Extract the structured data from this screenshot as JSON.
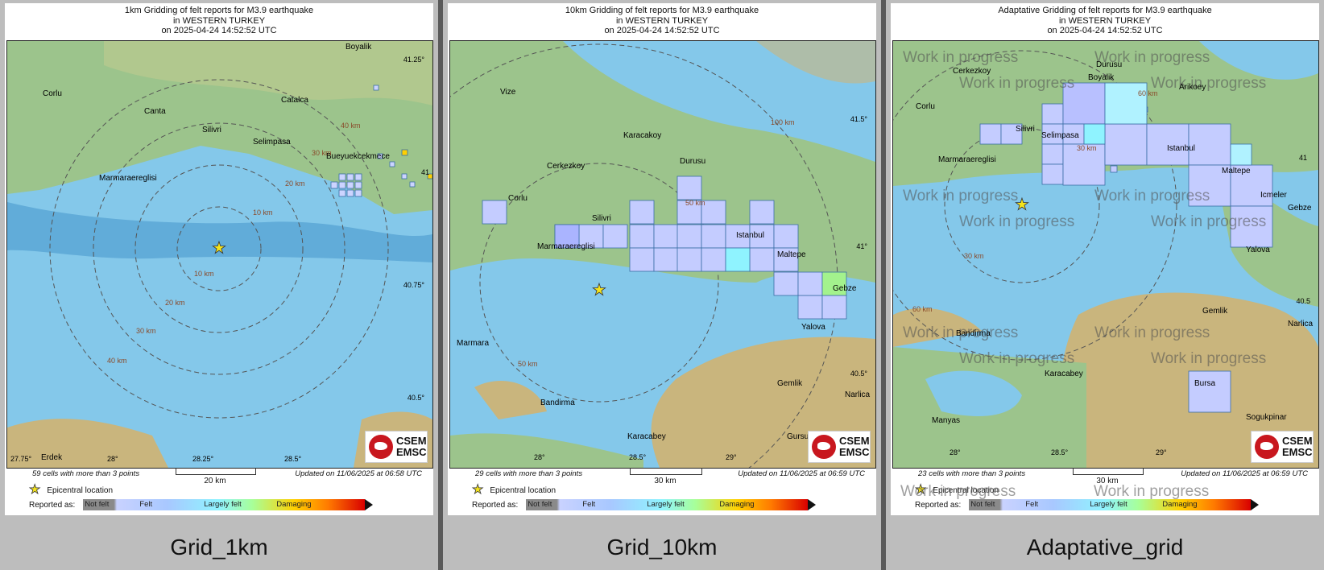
{
  "common": {
    "title_line1_suffix": "Gridding of felt reports for M3.9 earthquake",
    "title_line2": "in WESTERN TURKEY",
    "title_line3": "on  2025-04-24 14:52:52 UTC",
    "epicentral_label": "Epicentral location",
    "reported_as": "Reported as:",
    "legend": [
      "Not felt",
      "Felt",
      "Largely felt",
      "Damaging"
    ],
    "logo_top": "CSEM",
    "logo_bottom": "EMSC",
    "colors": {
      "sea": "#84c8ea",
      "deep_sea": "#3e8fc8",
      "land": "#9cc48c",
      "hills": "#c9b57d",
      "felt": "#c4ccff",
      "felt_cyan": "#8ff3ff",
      "largely": "#a3f28d"
    }
  },
  "panels": [
    {
      "title_line1": "1km Gridding of felt reports for M3.9 earthquake",
      "cells_text": "59 cells with more than 3 points",
      "updated_text": "Updated on 11/06/2025 at 06:58 UTC",
      "scale_label": "20 km",
      "caption": "Grid_1km",
      "places": [
        "Boyalik",
        "Corlu",
        "Canta",
        "Catalca",
        "Silivri",
        "Selimpasa",
        "Bueyuekcekmece",
        "Marmaraereglisi",
        "Erdek"
      ],
      "ring_labels": [
        "10 km",
        "20 km",
        "30 km",
        "40 km",
        "10 km",
        "20 km",
        "30 km",
        "40 km"
      ],
      "lat_labels": [
        "41.25°",
        "41",
        "40.75°",
        "40.5°"
      ],
      "lon_labels": [
        "27.75°",
        "28°",
        "28.25°",
        "28.5°"
      ],
      "watermark": ""
    },
    {
      "title_line1": "10km Gridding of felt reports for M3.9 earthquake",
      "cells_text": "29 cells with more than 3 points",
      "updated_text": "Updated on 11/06/2025 at 06:59 UTC",
      "scale_label": "30 km",
      "caption": "Grid_10km",
      "places": [
        "Vize",
        "Karacakoy",
        "Durusu",
        "Cerkezkoy",
        "Corlu",
        "Silivri",
        "Istanbul",
        "Marmaraereglisi",
        "Maltepe",
        "Gebze",
        "Yalova",
        "Marmara",
        "Gemlik",
        "Bandirma",
        "Narlica",
        "Karacabey",
        "Gursu"
      ],
      "ring_labels": [
        "50 km",
        "100 km",
        "50 km"
      ],
      "lat_labels": [
        "41.5°",
        "41°",
        "40.5°"
      ],
      "lon_labels": [
        "28°",
        "28.5°",
        "29°"
      ],
      "watermark": ""
    },
    {
      "title_line1": "Adaptative Gridding of felt reports for M3.9 earthquake",
      "cells_text": "23 cells with more than 3 points",
      "updated_text": "Updated on 11/06/2025 at 06:59 UTC",
      "scale_label": "30 km",
      "caption": "Adaptative_grid",
      "places": [
        "Durusu",
        "Cerkezkoy",
        "Boyalik",
        "Arikoey",
        "Corlu",
        "Silivri",
        "Selimpasa",
        "Istanbul",
        "Marmaraereglisi",
        "Maltepe",
        "Icmeler",
        "Gebze",
        "Yalova",
        "Gemlik",
        "Bandirma",
        "Narlica",
        "Karacabey",
        "Bursa",
        "Manyas",
        "Sogukpinar"
      ],
      "ring_labels": [
        "60 km",
        "30 km",
        "30 km",
        "60 km"
      ],
      "lat_labels": [
        "41",
        "40.5"
      ],
      "lon_labels": [
        "28°",
        "28.5°",
        "29°"
      ],
      "watermark": "Work in progress"
    }
  ]
}
